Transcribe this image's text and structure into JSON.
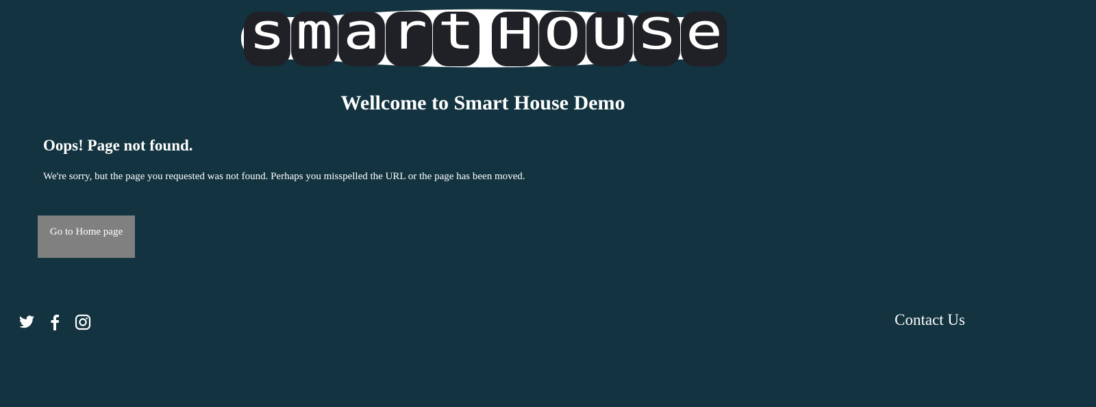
{
  "logo": {
    "text": "SMART HOUSE",
    "words": [
      "smart",
      "HOUSe"
    ],
    "colors": {
      "background": "#ffffff",
      "tile": "#202126",
      "letter": "#ffffff"
    }
  },
  "header": {
    "title": "Wellcome to Smart House Demo"
  },
  "main": {
    "heading": "Oops! Page not found.",
    "message": "We're sorry, but the page you requested was not found. Perhaps you misspelled the URL or the page has been moved.",
    "home_button": "Go to Home page"
  },
  "footer": {
    "social_icons": [
      "twitter-icon",
      "facebook-icon",
      "instagram-icon"
    ],
    "contact": "Contact Us"
  },
  "colors": {
    "page_background": "#12333f",
    "button": "#808080",
    "text": "#ffffff"
  }
}
